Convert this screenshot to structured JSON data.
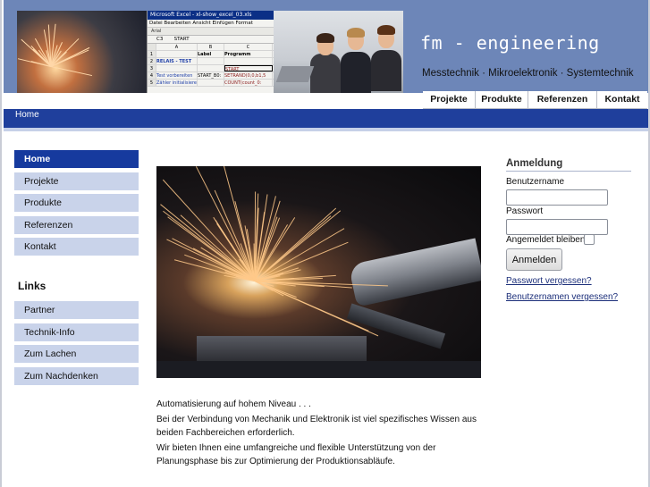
{
  "header": {
    "title": "fm - engineering",
    "subtitle": "Messtechnik · Mikroelektronik · Systemtechnik",
    "excel": {
      "window_title": "Microsoft Excel - xl-show_excel_03.xls",
      "menu": "Datei  Bearbeiten  Ansicht  Einfügen  Format",
      "toolbar": "Arial",
      "formula_cell": "C3",
      "formula_value": "START",
      "columns": [
        "",
        "A",
        "B",
        "C"
      ],
      "rows": [
        [
          "1",
          "",
          "Label",
          "Programm"
        ],
        [
          "2",
          "RELAIS - TEST",
          "",
          ""
        ],
        [
          "3",
          "",
          "",
          "START"
        ],
        [
          "4",
          "Test vorbereiten",
          "START_B0:",
          "SETRAND(0,0,b1,5"
        ],
        [
          "5",
          "Zähler initialisieren",
          "",
          "COUNT(count_0:"
        ]
      ]
    }
  },
  "topnav": {
    "items": [
      {
        "label": "Projekte"
      },
      {
        "label": "Produkte"
      },
      {
        "label": "Referenzen"
      },
      {
        "label": "Kontakt"
      }
    ]
  },
  "breadcrumb": "Home",
  "sidebar": {
    "items": [
      {
        "label": "Home"
      },
      {
        "label": "Projekte"
      },
      {
        "label": "Produkte"
      },
      {
        "label": "Referenzen"
      },
      {
        "label": "Kontakt"
      }
    ],
    "links_heading": "Links",
    "links": [
      {
        "label": "Partner"
      },
      {
        "label": "Technik-Info"
      },
      {
        "label": "Zum Lachen"
      },
      {
        "label": "Zum Nachdenken"
      }
    ]
  },
  "main": {
    "tagline": "Automatisierung auf hohem Niveau . . .",
    "paragraph1": "Bei der Verbindung von Mechanik und Elektronik ist viel spezifisches Wissen aus beiden Fachbereichen erforderlich.",
    "paragraph2": "Wir bieten Ihnen eine umfangreiche und flexible Unterstützung von der Planungsphase bis zur Optimierung der Produktionsabläufe."
  },
  "login": {
    "title": "Anmeldung",
    "username_label": "Benutzername",
    "username_value": "",
    "password_label": "Passwort",
    "password_value": "",
    "remember_label": "Angemeldet bleiben",
    "remember_checked": false,
    "submit_label": "Anmelden",
    "forgot_password": "Passwort vergessen?",
    "forgot_username": "Benutzernamen vergessen?"
  },
  "colors": {
    "header_bg": "#6d86b8",
    "nav_bar": "#1f3f9c",
    "sidebar_active": "#163a9e",
    "sidebar_item": "#c9d3ea"
  },
  "icons": {
    "remember_checkbox": "checkbox-empty-icon"
  }
}
